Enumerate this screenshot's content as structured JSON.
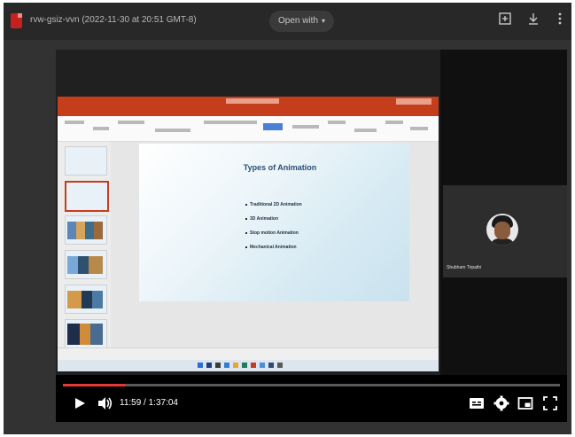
{
  "file": {
    "title": "rvw-gsiz-vvn (2022-11-30 at 20:51 GMT-8)",
    "open_with_label": "Open with",
    "icon": "file-video-icon"
  },
  "toolbar": {
    "icons": [
      "add-to-drive-icon",
      "download-icon",
      "more-vert-icon"
    ]
  },
  "slide": {
    "title": "Types of Animation",
    "bullets": [
      "Traditional 2D Animation",
      "3D Animation",
      "Stop motion Animation",
      "Mechanical Animation"
    ]
  },
  "participant": {
    "name": "Shubham Tripathi"
  },
  "player": {
    "time": "11:59 / 1:37:04",
    "progress_fraction": 0.125,
    "progress_color": "#e53935",
    "icons": [
      "play-icon",
      "volume-icon",
      "captions-icon",
      "settings-icon",
      "miniplayer-icon",
      "fullscreen-icon"
    ]
  }
}
